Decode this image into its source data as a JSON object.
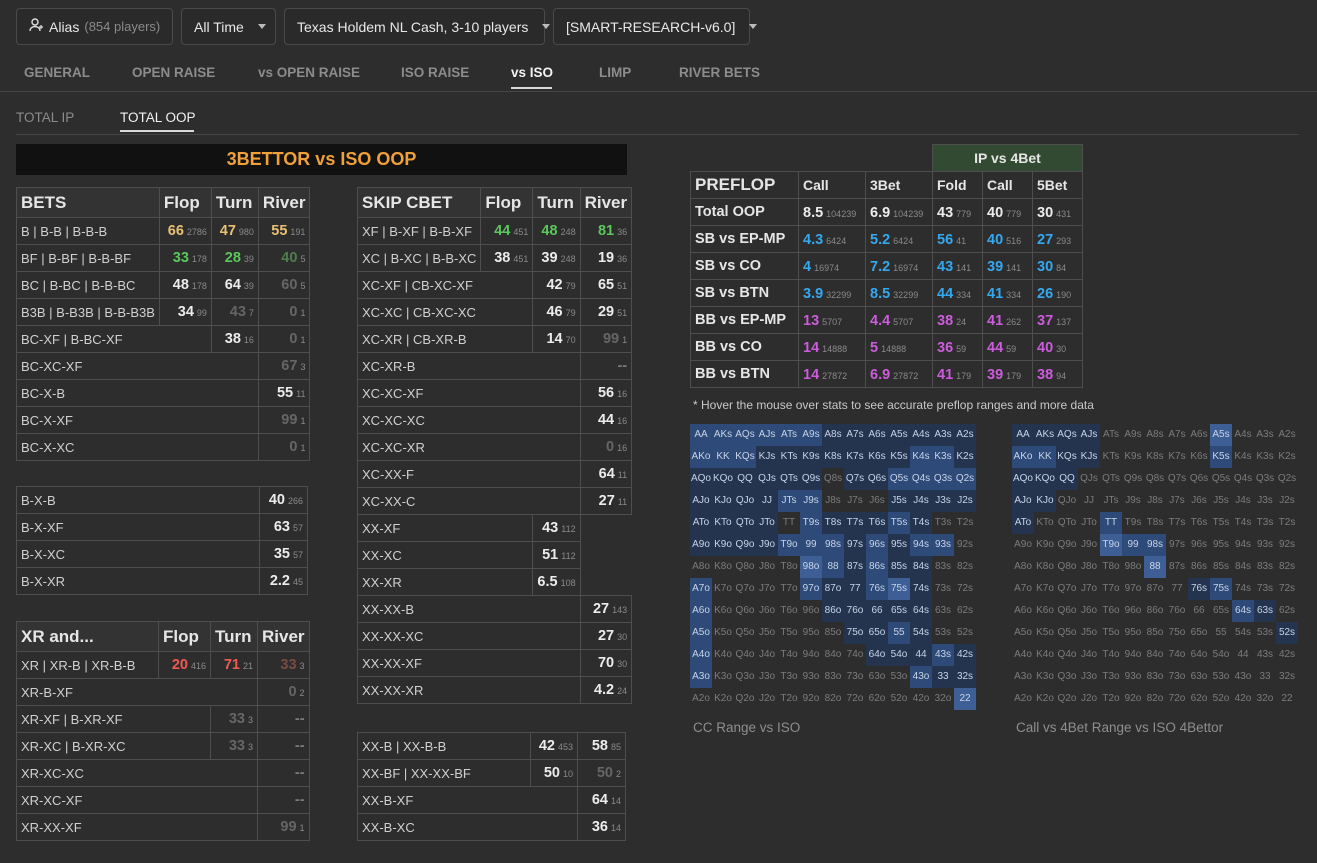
{
  "filters": {
    "alias_label": "Alias",
    "alias_count": "(854 players)",
    "time": "All Time",
    "game": "Texas Holdem NL Cash, 3-10 players",
    "model": "[SMART-RESEARCH-v6.0]"
  },
  "main_tabs": [
    "GENERAL",
    "OPEN RAISE",
    "vs OPEN RAISE",
    "ISO RAISE",
    "vs ISO",
    "LIMP",
    "RIVER BETS"
  ],
  "sub_tabs": [
    "TOTAL IP",
    "TOTAL OOP"
  ],
  "banner": "3BETTOR vs ISO OOP",
  "bets": {
    "header": [
      "BETS",
      "Flop",
      "Turn",
      "River"
    ],
    "rows": [
      {
        "label": "B | B-B | B-B-B",
        "cells": [
          {
            "v": "66",
            "n": "2786",
            "c": "y"
          },
          {
            "v": "47",
            "n": "980",
            "c": "y"
          },
          {
            "v": "55",
            "n": "191",
            "c": "y"
          }
        ]
      },
      {
        "label": "BF | B-BF | B-B-BF",
        "cells": [
          {
            "v": "33",
            "n": "178",
            "c": "g"
          },
          {
            "v": "28",
            "n": "39",
            "c": "g"
          },
          {
            "v": "40",
            "n": "5",
            "c": "gd"
          }
        ]
      },
      {
        "label": "BC | B-BC | B-B-BC",
        "cells": [
          {
            "v": "48",
            "n": "178",
            "c": "w"
          },
          {
            "v": "64",
            "n": "39",
            "c": "w"
          },
          {
            "v": "60",
            "n": "5",
            "c": "gr"
          }
        ]
      },
      {
        "label": "B3B | B-B3B | B-B-B3B",
        "cells": [
          {
            "v": "34",
            "n": "99",
            "c": "w"
          },
          {
            "v": "43",
            "n": "7",
            "c": "gr"
          },
          {
            "v": "0",
            "n": "1",
            "c": "gr"
          }
        ]
      },
      {
        "label": "BC-XF | B-BC-XF",
        "cells": [
          null,
          {
            "v": "38",
            "n": "16",
            "c": "w"
          },
          {
            "v": "0",
            "n": "1",
            "c": "gr"
          }
        ]
      },
      {
        "label": "BC-XC-XF",
        "cells": [
          null,
          null,
          {
            "v": "67",
            "n": "3",
            "c": "gr"
          }
        ]
      },
      {
        "label": "BC-X-B",
        "cells": [
          null,
          null,
          {
            "v": "55",
            "n": "11",
            "c": "w"
          }
        ]
      },
      {
        "label": "BC-X-XF",
        "cells": [
          null,
          null,
          {
            "v": "99",
            "n": "1",
            "c": "gr"
          }
        ]
      },
      {
        "label": "BC-X-XC",
        "cells": [
          null,
          null,
          {
            "v": "0",
            "n": "1",
            "c": "gr"
          }
        ]
      }
    ],
    "rows2": [
      {
        "label": "B-X-B",
        "cells": [
          null,
          null,
          {
            "v": "40",
            "n": "266",
            "c": "w"
          }
        ]
      },
      {
        "label": "B-X-XF",
        "cells": [
          null,
          null,
          {
            "v": "63",
            "n": "57",
            "c": "w"
          }
        ]
      },
      {
        "label": "B-X-XC",
        "cells": [
          null,
          null,
          {
            "v": "35",
            "n": "57",
            "c": "w"
          }
        ]
      },
      {
        "label": "B-X-XR",
        "cells": [
          null,
          null,
          {
            "v": "2.2",
            "n": "45",
            "c": "w"
          }
        ]
      }
    ]
  },
  "xr": {
    "header": [
      "XR and...",
      "Flop",
      "Turn",
      "River"
    ],
    "rows": [
      {
        "label": "XR | XR-B | XR-B-B",
        "cells": [
          {
            "v": "20",
            "n": "416",
            "c": "r"
          },
          {
            "v": "71",
            "n": "21",
            "c": "r"
          },
          {
            "v": "33",
            "n": "3",
            "c": "rd"
          }
        ]
      },
      {
        "label": "XR-B-XF",
        "cells": [
          null,
          null,
          {
            "v": "0",
            "n": "2",
            "c": "gr"
          }
        ]
      },
      {
        "label": "XR-XF | B-XR-XF",
        "cells": [
          null,
          {
            "v": "33",
            "n": "3",
            "c": "gr"
          },
          {
            "v": "--",
            "n": "",
            "c": "dash"
          }
        ]
      },
      {
        "label": "XR-XC | B-XR-XC",
        "cells": [
          null,
          {
            "v": "33",
            "n": "3",
            "c": "gr"
          },
          {
            "v": "--",
            "n": "",
            "c": "dash"
          }
        ]
      },
      {
        "label": "XR-XC-XC",
        "cells": [
          null,
          null,
          {
            "v": "--",
            "n": "",
            "c": "dash"
          }
        ]
      },
      {
        "label": "XR-XC-XF",
        "cells": [
          null,
          null,
          {
            "v": "--",
            "n": "",
            "c": "dash"
          }
        ]
      },
      {
        "label": "XR-XX-XF",
        "cells": [
          null,
          null,
          {
            "v": "99",
            "n": "1",
            "c": "gr"
          }
        ]
      }
    ]
  },
  "skip": {
    "header": [
      "SKIP CBET",
      "Flop",
      "Turn",
      "River"
    ],
    "rows": [
      {
        "label": "XF | B-XF | B-B-XF",
        "cells": [
          {
            "v": "44",
            "n": "451",
            "c": "g"
          },
          {
            "v": "48",
            "n": "248",
            "c": "g"
          },
          {
            "v": "81",
            "n": "36",
            "c": "g"
          }
        ]
      },
      {
        "label": "XC | B-XC | B-B-XC",
        "cells": [
          {
            "v": "38",
            "n": "451",
            "c": "w"
          },
          {
            "v": "39",
            "n": "248",
            "c": "w"
          },
          {
            "v": "19",
            "n": "36",
            "c": "w"
          }
        ]
      },
      {
        "label": "XC-XF | CB-XC-XF",
        "cells": [
          null,
          {
            "v": "42",
            "n": "79",
            "c": "w"
          },
          {
            "v": "65",
            "n": "51",
            "c": "w"
          }
        ]
      },
      {
        "label": "XC-XC | CB-XC-XC",
        "cells": [
          null,
          {
            "v": "46",
            "n": "79",
            "c": "w"
          },
          {
            "v": "29",
            "n": "51",
            "c": "w"
          }
        ]
      },
      {
        "label": "XC-XR | CB-XR-B",
        "cells": [
          null,
          {
            "v": "14",
            "n": "70",
            "c": "w"
          },
          {
            "v": "99",
            "n": "1",
            "c": "gr"
          }
        ]
      },
      {
        "label": "XC-XR-B",
        "cells": [
          null,
          null,
          {
            "v": "--",
            "n": "",
            "c": "dash"
          }
        ]
      },
      {
        "label": "XC-XC-XF",
        "cells": [
          null,
          null,
          {
            "v": "56",
            "n": "16",
            "c": "w"
          }
        ]
      },
      {
        "label": "XC-XC-XC",
        "cells": [
          null,
          null,
          {
            "v": "44",
            "n": "16",
            "c": "w"
          }
        ]
      },
      {
        "label": "XC-XC-XR",
        "cells": [
          null,
          null,
          {
            "v": "0",
            "n": "16",
            "c": "gr"
          }
        ]
      },
      {
        "label": "XC-XX-F",
        "cells": [
          null,
          null,
          {
            "v": "64",
            "n": "11",
            "c": "w"
          }
        ]
      },
      {
        "label": "XC-XX-C",
        "cells": [
          null,
          null,
          {
            "v": "27",
            "n": "11",
            "c": "w"
          }
        ]
      },
      {
        "label": "XX-XF",
        "cells": [
          null,
          {
            "v": "43",
            "n": "112",
            "c": "w"
          },
          null
        ]
      },
      {
        "label": "XX-XC",
        "cells": [
          null,
          {
            "v": "51",
            "n": "112",
            "c": "w"
          },
          null
        ]
      },
      {
        "label": "XX-XR",
        "cells": [
          null,
          {
            "v": "6.5",
            "n": "108",
            "c": "w"
          },
          null
        ]
      },
      {
        "label": "XX-XX-B",
        "cells": [
          null,
          null,
          {
            "v": "27",
            "n": "143",
            "c": "w"
          }
        ]
      },
      {
        "label": "XX-XX-XC",
        "cells": [
          null,
          null,
          {
            "v": "27",
            "n": "30",
            "c": "w"
          }
        ]
      },
      {
        "label": "XX-XX-XF",
        "cells": [
          null,
          null,
          {
            "v": "70",
            "n": "30",
            "c": "w"
          }
        ]
      },
      {
        "label": "XX-XX-XR",
        "cells": [
          null,
          null,
          {
            "v": "4.2",
            "n": "24",
            "c": "w"
          }
        ]
      }
    ],
    "rows2": [
      {
        "label": "XX-B | XX-B-B",
        "cells": [
          null,
          {
            "v": "42",
            "n": "453",
            "c": "w"
          },
          {
            "v": "58",
            "n": "85",
            "c": "w"
          }
        ]
      },
      {
        "label": "XX-BF | XX-XX-BF",
        "cells": [
          null,
          {
            "v": "50",
            "n": "10",
            "c": "w"
          },
          {
            "v": "50",
            "n": "2",
            "c": "gr"
          }
        ]
      },
      {
        "label": "XX-B-XF",
        "cells": [
          null,
          null,
          {
            "v": "64",
            "n": "14",
            "c": "w"
          }
        ]
      },
      {
        "label": "XX-B-XC",
        "cells": [
          null,
          null,
          {
            "v": "36",
            "n": "14",
            "c": "w"
          }
        ]
      }
    ]
  },
  "preflop": {
    "group_header": "IP vs 4Bet",
    "header": [
      "PREFLOP",
      "Call",
      "3Bet",
      "Fold",
      "Call",
      "5Bet"
    ],
    "rows": [
      {
        "label": "Total OOP",
        "cells": [
          {
            "v": "8.5",
            "n": "104239",
            "c": "w"
          },
          {
            "v": "6.9",
            "n": "104239",
            "c": "w"
          },
          {
            "v": "43",
            "n": "779",
            "c": "w"
          },
          {
            "v": "40",
            "n": "779",
            "c": "w"
          },
          {
            "v": "30",
            "n": "431",
            "c": "w"
          }
        ]
      },
      {
        "label": "SB vs EP-MP",
        "cells": [
          {
            "v": "4.3",
            "n": "6424",
            "c": "b"
          },
          {
            "v": "5.2",
            "n": "6424",
            "c": "b"
          },
          {
            "v": "56",
            "n": "41",
            "c": "b"
          },
          {
            "v": "40",
            "n": "516",
            "c": "b"
          },
          {
            "v": "27",
            "n": "293",
            "c": "b"
          }
        ]
      },
      {
        "label": "SB vs CO",
        "cells": [
          {
            "v": "4",
            "n": "16974",
            "c": "b"
          },
          {
            "v": "7.2",
            "n": "16974",
            "c": "b"
          },
          {
            "v": "43",
            "n": "141",
            "c": "b"
          },
          {
            "v": "39",
            "n": "141",
            "c": "b"
          },
          {
            "v": "30",
            "n": "84",
            "c": "b"
          }
        ]
      },
      {
        "label": "SB vs BTN",
        "cells": [
          {
            "v": "3.9",
            "n": "32299",
            "c": "b"
          },
          {
            "v": "8.5",
            "n": "32299",
            "c": "b"
          },
          {
            "v": "44",
            "n": "334",
            "c": "b"
          },
          {
            "v": "41",
            "n": "334",
            "c": "b"
          },
          {
            "v": "26",
            "n": "190",
            "c": "b"
          }
        ]
      },
      {
        "label": "BB vs EP-MP",
        "cells": [
          {
            "v": "13",
            "n": "5707",
            "c": "m"
          },
          {
            "v": "4.4",
            "n": "5707",
            "c": "m"
          },
          {
            "v": "38",
            "n": "24",
            "c": "m"
          },
          {
            "v": "41",
            "n": "262",
            "c": "m"
          },
          {
            "v": "37",
            "n": "137",
            "c": "m"
          }
        ]
      },
      {
        "label": "BB vs CO",
        "cells": [
          {
            "v": "14",
            "n": "14888",
            "c": "m"
          },
          {
            "v": "5",
            "n": "14888",
            "c": "m"
          },
          {
            "v": "36",
            "n": "59",
            "c": "m"
          },
          {
            "v": "44",
            "n": "59",
            "c": "m"
          },
          {
            "v": "40",
            "n": "30",
            "c": "m"
          }
        ]
      },
      {
        "label": "BB vs BTN",
        "cells": [
          {
            "v": "14",
            "n": "27872",
            "c": "m"
          },
          {
            "v": "6.9",
            "n": "27872",
            "c": "m"
          },
          {
            "v": "41",
            "n": "179",
            "c": "m"
          },
          {
            "v": "39",
            "n": "179",
            "c": "m"
          },
          {
            "v": "38",
            "n": "94",
            "c": "m"
          }
        ]
      }
    ]
  },
  "note": "* Hover the mouse over stats to see accurate preflop ranges and more data",
  "range_caption_1": "CC Range vs ISO",
  "range_caption_2": "Call vs 4Bet Range vs ISO 4Bettor",
  "range1_rows": [
    "2222221111111",
    "2221111111221",
    "1111110112222",
    "1111220001111",
    "1111021112100",
    "1111222121220",
    "0000032121100",
    "2000021123100",
    "2000001111100",
    "2000000112100",
    "2000000011121",
    "2000000000211",
    "0000000000003"
  ],
  "range2_rows": [
    "1111000003000",
    "2211000002000",
    "1110000000000",
    "1100000000000",
    "1000200000000",
    "0000322000000",
    "0000003000000",
    "0000000012000",
    "0000000000210",
    "0000000000001",
    "0000000000000",
    "0000000000000",
    "0000000000000"
  ],
  "colors": {
    "yellow": "#e8c170",
    "green": "#5bc85b",
    "red": "#f05a52",
    "blue": "#35a8f0",
    "magenta": "#cc5cdc",
    "accent": "#f0a038"
  }
}
